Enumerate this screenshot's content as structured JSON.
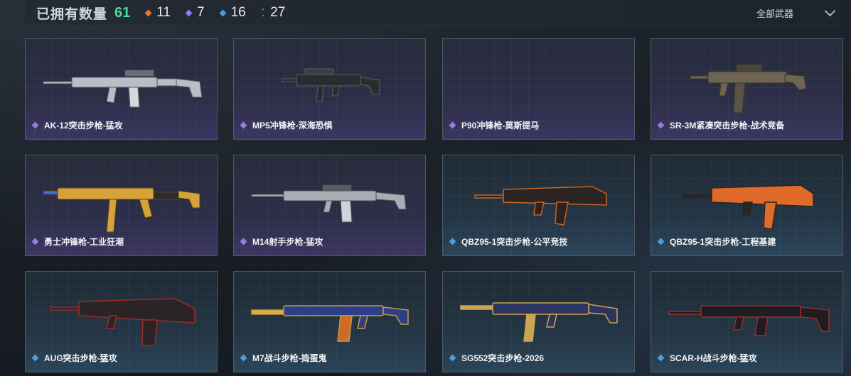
{
  "header": {
    "owned_label": "已拥有数量",
    "owned_count": "61",
    "stats": [
      {
        "icon": "orange-diamond-icon",
        "color": "#e07a3a",
        "value": "11"
      },
      {
        "icon": "purple-diamond-icon",
        "color": "#9a7ae0",
        "value": "7"
      },
      {
        "icon": "blue-diamond-icon",
        "color": "#4a9ee0",
        "value": "16"
      },
      {
        "icon": "green-dots-icon",
        "color": "#3ee3b0",
        "value": "27"
      }
    ],
    "filter_label": "全部武器"
  },
  "colors": {
    "epic": "#9a7ae0",
    "rare": "#4a9ee0",
    "accent_green": "#3ee39a"
  },
  "weapons": [
    {
      "name": "AK-12突击步枪-猛攻",
      "rarity": "epic",
      "skin": "silver"
    },
    {
      "name": "MP5冲锋枪-深海恐惧",
      "rarity": "epic",
      "skin": "black"
    },
    {
      "name": "P90冲锋枪-莫斯提马",
      "rarity": "epic",
      "skin": "none"
    },
    {
      "name": "SR-3M紧凑突击步枪-战术竞备",
      "rarity": "epic",
      "skin": "camo"
    },
    {
      "name": "勇士冲锋枪-工业狂潮",
      "rarity": "epic",
      "skin": "gold"
    },
    {
      "name": "M14射手步枪-猛攻",
      "rarity": "epic",
      "skin": "silver"
    },
    {
      "name": "QBZ95-1突击步枪-公平竞技",
      "rarity": "rare",
      "skin": "orange-black"
    },
    {
      "name": "QBZ95-1突击步枪-工程基建",
      "rarity": "rare",
      "skin": "orange"
    },
    {
      "name": "AUG突击步枪-猛攻",
      "rarity": "rare",
      "skin": "red"
    },
    {
      "name": "M7战斗步枪-捣蛋鬼",
      "rarity": "rare",
      "skin": "navy-gold"
    },
    {
      "name": "SG552突击步枪-2026",
      "rarity": "rare",
      "skin": "blue-gold"
    },
    {
      "name": "SCAR-H战斗步枪-猛攻",
      "rarity": "rare",
      "skin": "red"
    }
  ]
}
